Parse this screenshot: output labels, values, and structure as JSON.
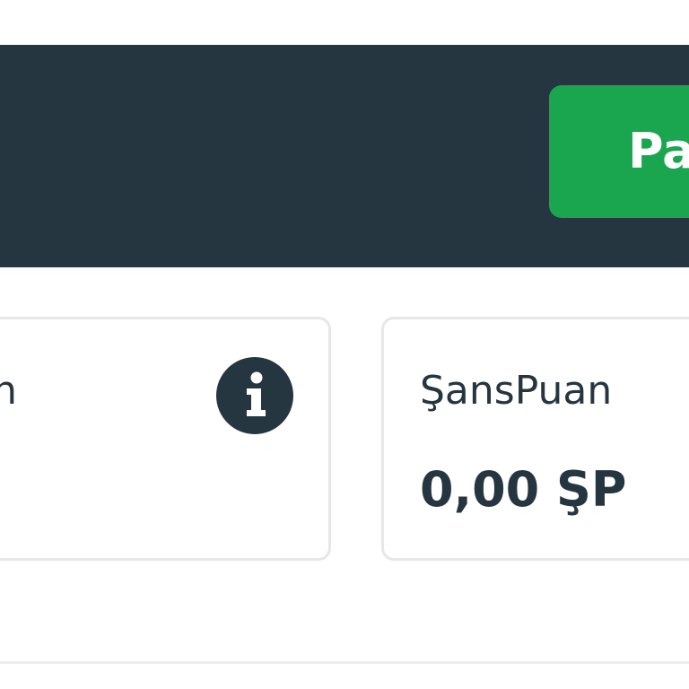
{
  "header": {
    "action_button_label": "Pa"
  },
  "cards": {
    "left": {
      "title_fragment": "n",
      "icon": "info-icon"
    },
    "right": {
      "title": "ŞansPuan",
      "value": "0,00 ŞP"
    }
  },
  "colors": {
    "header_background": "#263640",
    "accent_green": "#1aa64f",
    "text_dark": "#263640",
    "card_border": "#e7e7e7"
  }
}
